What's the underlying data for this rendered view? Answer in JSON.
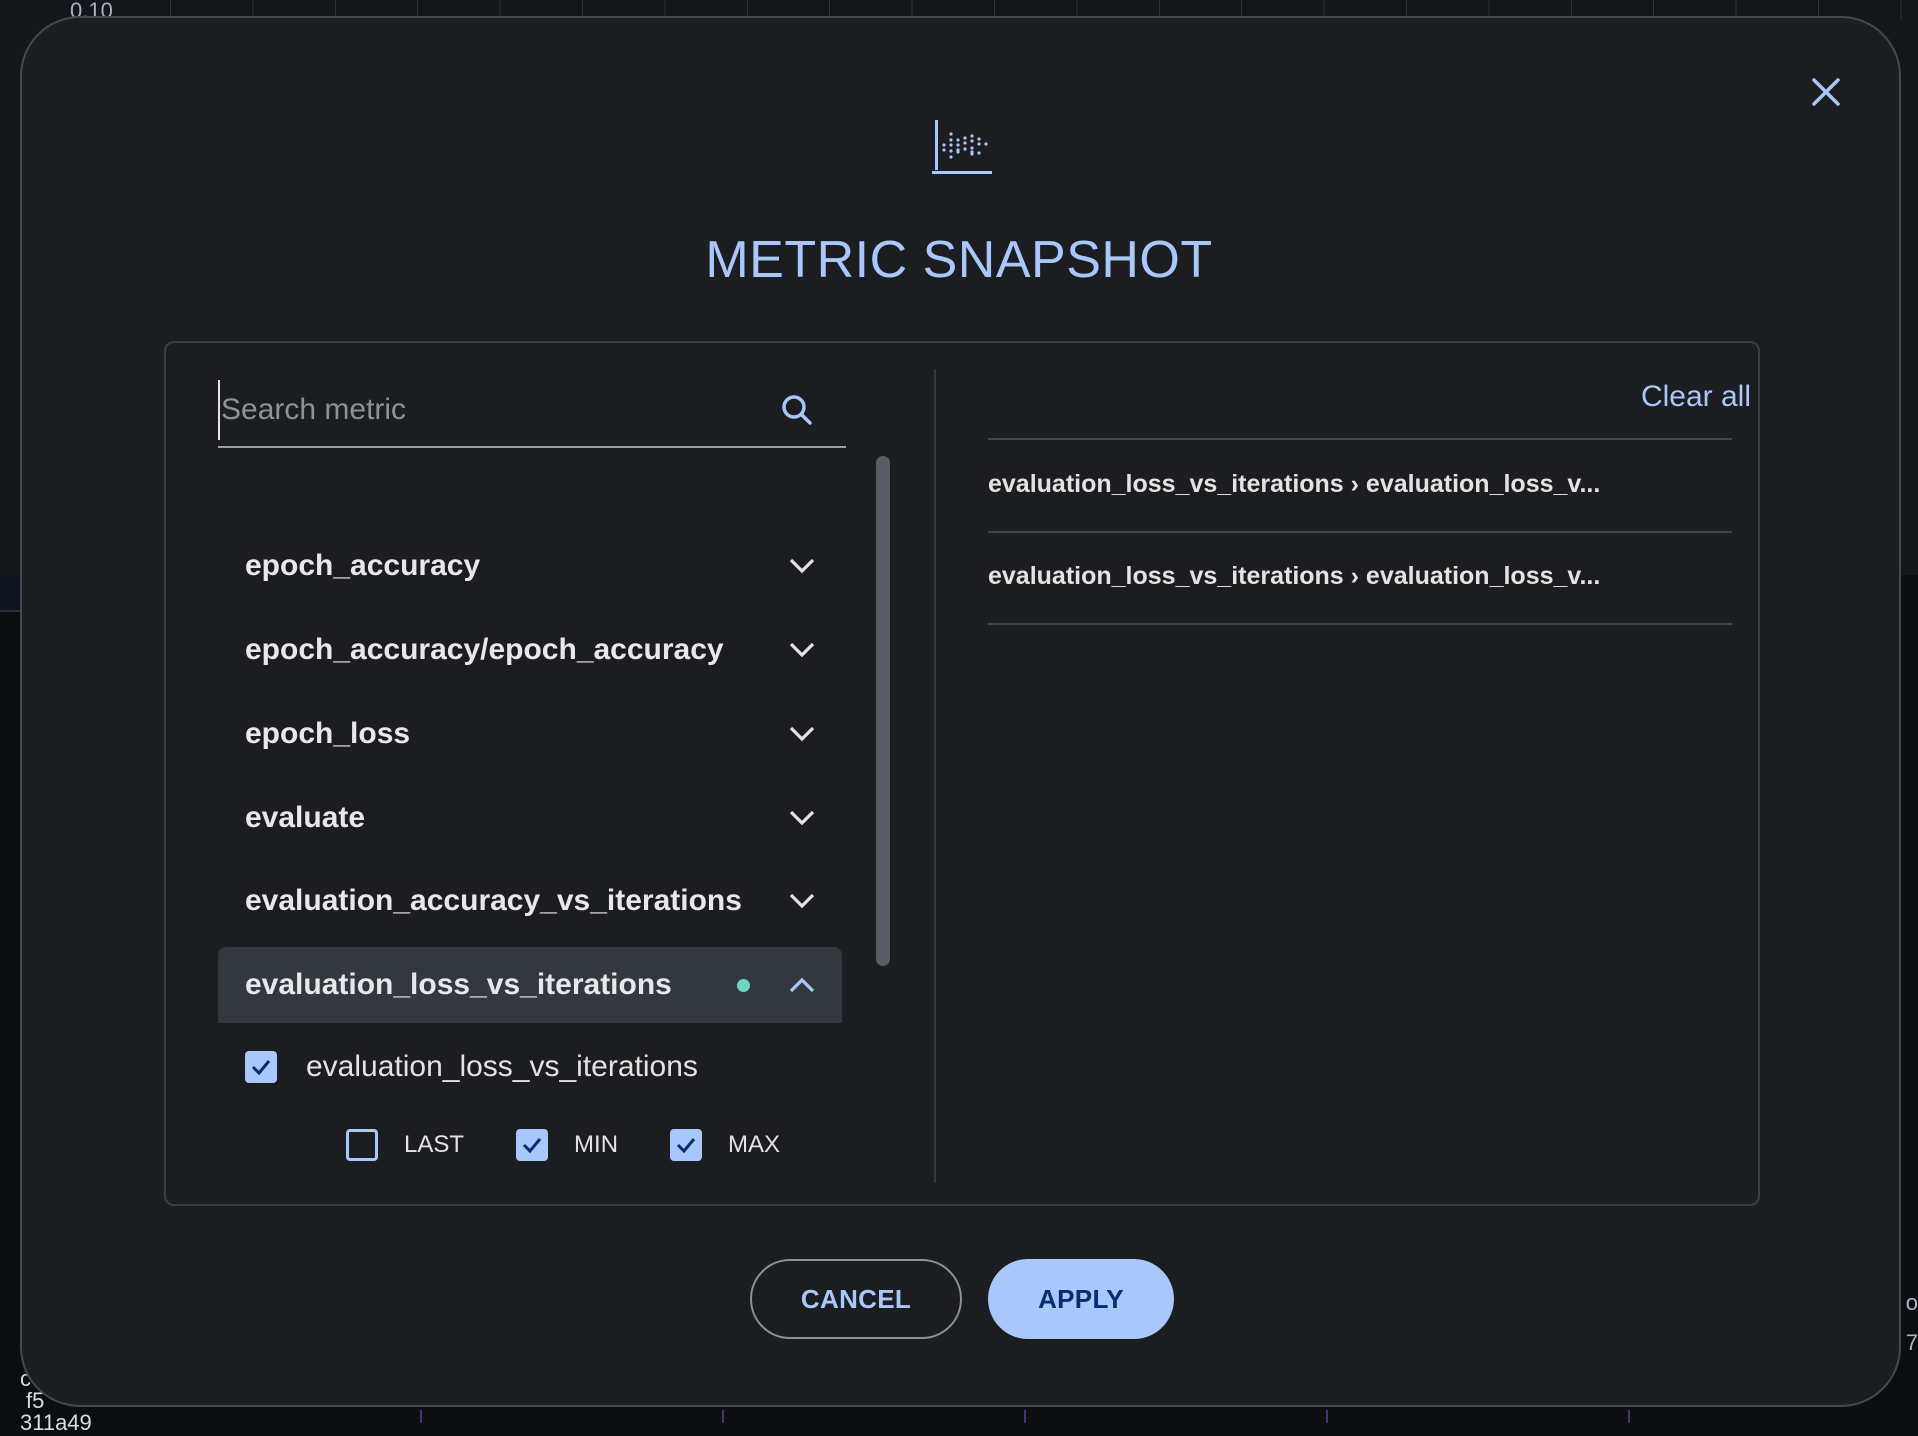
{
  "background": {
    "tick_label": "0.10",
    "left_labels": [
      "c",
      "f5",
      "311a49"
    ],
    "right_labels": [
      "o",
      "7"
    ]
  },
  "modal": {
    "title": "METRIC SNAPSHOT",
    "header_icon": "scatter-chart-icon",
    "close_icon": "close-icon",
    "search": {
      "value": "",
      "placeholder": "Search metric",
      "icon": "search-icon"
    },
    "metrics": [
      {
        "label": "epoch_accuracy",
        "expanded": false,
        "has_selection": false
      },
      {
        "label": "epoch_accuracy/epoch_accuracy",
        "expanded": false,
        "has_selection": false
      },
      {
        "label": "epoch_loss",
        "expanded": false,
        "has_selection": false
      },
      {
        "label": "evaluate",
        "expanded": false,
        "has_selection": false
      },
      {
        "label": "evaluation_accuracy_vs_iterations",
        "expanded": false,
        "has_selection": false
      },
      {
        "label": "evaluation_loss_vs_iterations",
        "expanded": true,
        "has_selection": true
      }
    ],
    "expanded_child": {
      "label": "evaluation_loss_vs_iterations",
      "checked": true,
      "stats": [
        {
          "label": "LAST",
          "checked": false
        },
        {
          "label": "MIN",
          "checked": true
        },
        {
          "label": "MAX",
          "checked": true
        }
      ]
    },
    "selected_panel": {
      "clear_all_label": "Clear all",
      "items": [
        "evaluation_loss_vs_iterations › evaluation_loss_v...",
        "evaluation_loss_vs_iterations › evaluation_loss_v..."
      ]
    },
    "buttons": {
      "cancel_label": "CANCEL",
      "apply_label": "APPLY"
    },
    "colors": {
      "accent": "#a8c7fa",
      "selection_dot": "#6dd5c0",
      "apply_text": "#062e6f"
    }
  }
}
